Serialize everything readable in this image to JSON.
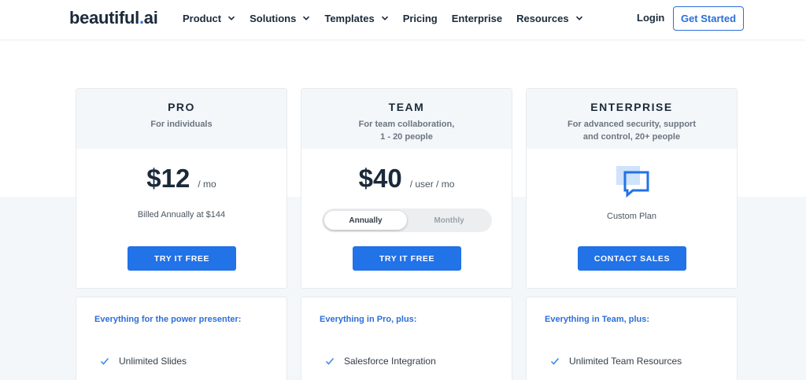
{
  "header": {
    "logo_main": "beautiful",
    "logo_dot": ".",
    "logo_tail": "ai",
    "nav": [
      {
        "label": "Product",
        "dropdown": true
      },
      {
        "label": "Solutions",
        "dropdown": true
      },
      {
        "label": "Templates",
        "dropdown": true
      },
      {
        "label": "Pricing",
        "dropdown": false
      },
      {
        "label": "Enterprise",
        "dropdown": false
      },
      {
        "label": "Resources",
        "dropdown": true
      }
    ],
    "login": "Login",
    "get_started": "Get Started"
  },
  "plans": [
    {
      "name": "PRO",
      "subtitle": "For individuals",
      "price": "$12",
      "per": "/ mo",
      "billed": "Billed Annually at $144",
      "cta": "TRY IT FREE"
    },
    {
      "name": "TEAM",
      "subtitle": "For team collaboration,\n1 - 20 people",
      "price": "$40",
      "per": "/ user / mo",
      "toggle": {
        "selected": "Annually",
        "other": "Monthly"
      },
      "cta": "TRY IT FREE"
    },
    {
      "name": "ENTERPRISE",
      "subtitle": "For advanced security, support\nand control, 20+ people",
      "icon": "chat-bubble-icon",
      "custom": "Custom Plan",
      "cta": "CONTACT SALES"
    }
  ],
  "features": [
    {
      "heading": "Everything for the power presenter:",
      "items": [
        "Unlimited Slides"
      ]
    },
    {
      "heading": "Everything in Pro, plus:",
      "items": [
        "Salesforce Integration"
      ]
    },
    {
      "heading": "Everything in Team, plus:",
      "items": [
        "Unlimited Team Resources"
      ]
    }
  ],
  "colors": {
    "accent": "#2272e8",
    "heading_dark": "#1b2a3a",
    "band": "#f4f7fa"
  }
}
